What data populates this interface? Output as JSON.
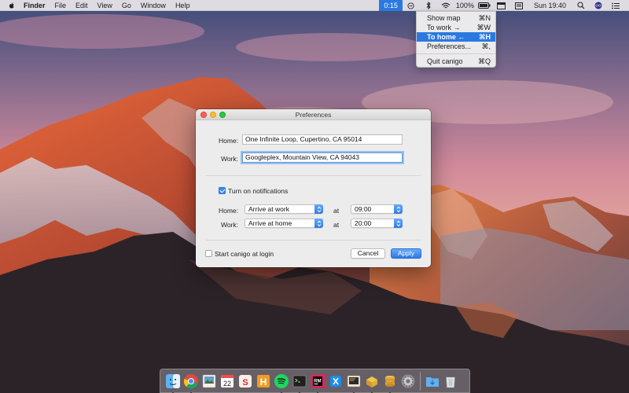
{
  "menubar": {
    "apple_icon": "apple-icon",
    "app_name": "Finder",
    "menus": [
      "File",
      "Edit",
      "View",
      "Go",
      "Window",
      "Help"
    ],
    "timer": "0:15",
    "battery": "100%",
    "clock": "Sun 19:40"
  },
  "status_menu": {
    "items": [
      {
        "label": "Show map",
        "shortcut": "⌘N"
      },
      {
        "label": "To work →",
        "shortcut": "⌘W"
      },
      {
        "label": "To home ←",
        "shortcut": "⌘H"
      },
      {
        "label": "Preferences...",
        "shortcut": "⌘,"
      }
    ],
    "highlighted_index": 2,
    "quit": {
      "label": "Quit canigo",
      "shortcut": "⌘Q"
    }
  },
  "preferences": {
    "title": "Preferences",
    "home_label": "Home:",
    "home_value": "One Infinite Loop, Cupertino, CA 95014",
    "work_label": "Work:",
    "work_value": "Googleplex, Mountain View, CA 94043",
    "notifications_label": "Turn on notifications",
    "notifications_checked": true,
    "home_row_label": "Home:",
    "home_event": "Arrive at work",
    "home_at": "at",
    "home_time": "09:00",
    "work_row_label": "Work:",
    "work_event": "Arrive at home",
    "work_at": "at",
    "work_time": "20:00",
    "login_label": "Start canigo at login",
    "login_checked": false,
    "cancel_label": "Cancel",
    "apply_label": "Apply"
  },
  "dock": {
    "apps": [
      "finder-icon",
      "chrome-icon",
      "preview-icon",
      "calendar-icon",
      "slack-icon",
      "h-app-icon",
      "spotify-icon",
      "terminal-icon",
      "rubymine-icon",
      "xcode-icon",
      "console-icon",
      "archive-icon",
      "sequel-icon",
      "system-preferences-icon",
      "downloads-folder-icon",
      "trash-icon"
    ],
    "calendar_day": "22",
    "hyper_letter": "H",
    "rubymine_letters": "RM",
    "slack_letter": "S"
  },
  "colors": {
    "accent": "#2b79e0",
    "close": "#fc5f57",
    "minimize": "#fdbc2e",
    "maximize": "#28c840"
  }
}
